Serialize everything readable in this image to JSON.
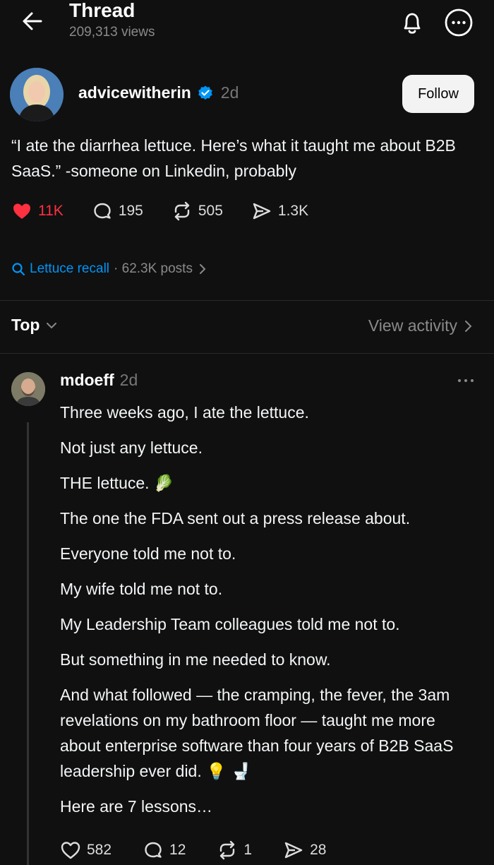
{
  "header": {
    "title": "Thread",
    "views": "209,313 views",
    "icons": [
      "back-arrow-icon",
      "bell-icon",
      "more-circle-icon"
    ]
  },
  "post": {
    "author": "advicewitherin",
    "time": "2d",
    "follow_label": "Follow",
    "text": "“I ate the diarrhea lettuce. Here’s what it taught me about B2B SaaS.” -someone on Linkedin, probably",
    "likes": "11K",
    "comments": "195",
    "reposts": "505",
    "shares": "1.3K",
    "topic": "Lettuce recall",
    "topic_count": "· 62.3K posts"
  },
  "sort": {
    "label": "Top",
    "view_activity": "View activity"
  },
  "reply": {
    "author": "mdoeff",
    "time": "2d",
    "paragraphs": [
      "Three weeks ago, I ate the lettuce.",
      "Not just any lettuce.",
      "THE lettuce. 🥬",
      "The one the FDA sent out a press release about.",
      "Everyone told me not to.",
      "My wife told me not to.",
      "My Leadership Team colleagues told me not to.",
      "But something in me needed to know.",
      "And what followed — the cramping, the fever, the 3am revelations on my bathroom floor — taught me more about enterprise software than four years of B2B SaaS leadership ever did. 💡 🚽",
      "Here are 7 lessons…"
    ],
    "likes": "582",
    "comments": "12",
    "reposts": "1",
    "shares": "28"
  },
  "colors": {
    "background": "#101010",
    "like_red": "#ff3040",
    "link_blue": "#0095f6",
    "verified_blue": "#0095f6"
  }
}
